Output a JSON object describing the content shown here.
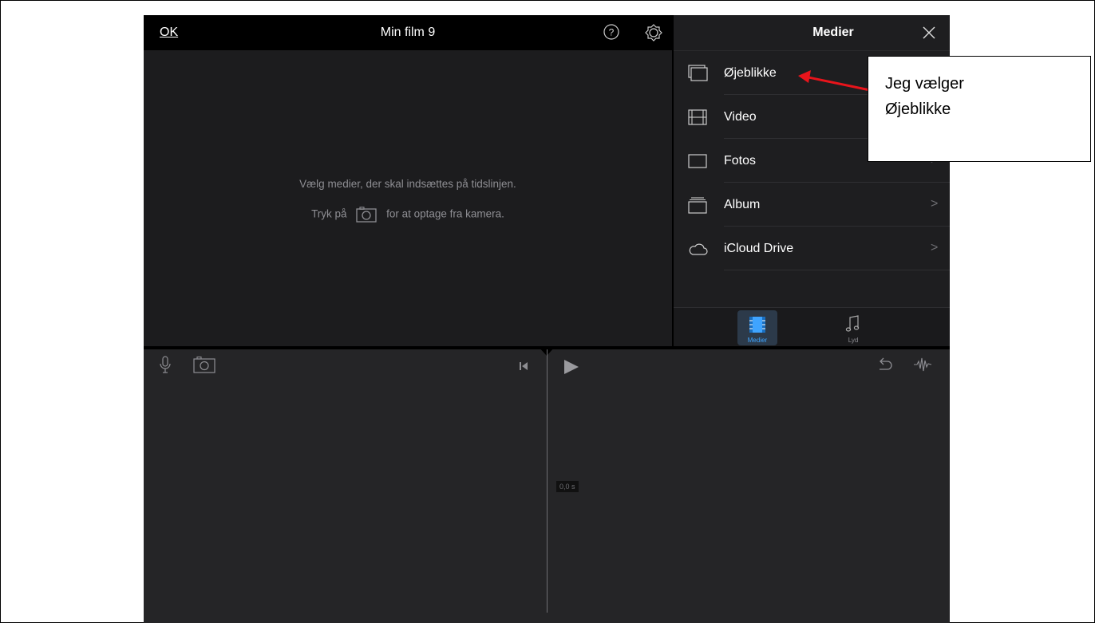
{
  "topbar": {
    "ok_label": "OK",
    "title": "Min film 9"
  },
  "viewer": {
    "hint_line1": "Vælg medier, der skal indsættes på tidslinjen.",
    "hint_prefix": "Tryk på",
    "hint_suffix": "for at optage fra kamera."
  },
  "panel": {
    "title": "Medier",
    "items": [
      {
        "label": "Øjeblikke",
        "icon": "moments-icon",
        "chevron": ">"
      },
      {
        "label": "Video",
        "icon": "film-icon",
        "chevron": ">"
      },
      {
        "label": "Fotos",
        "icon": "photos-icon",
        "chevron": ">"
      },
      {
        "label": "Album",
        "icon": "album-icon",
        "chevron": ">"
      },
      {
        "label": "iCloud Drive",
        "icon": "cloud-icon",
        "chevron": ">"
      }
    ],
    "tabs": [
      {
        "label": "Medier",
        "icon": "media-icon",
        "active": true
      },
      {
        "label": "Lyd",
        "icon": "music-note-icon",
        "active": false
      }
    ]
  },
  "timeline": {
    "time_label": "0,0 s"
  },
  "callout": {
    "line1": "Jeg vælger",
    "line2": "Øjeblikke"
  },
  "colors": {
    "accent": "#3fa4ff",
    "arrow": "#e8141b",
    "background": "#1c1c1e"
  }
}
